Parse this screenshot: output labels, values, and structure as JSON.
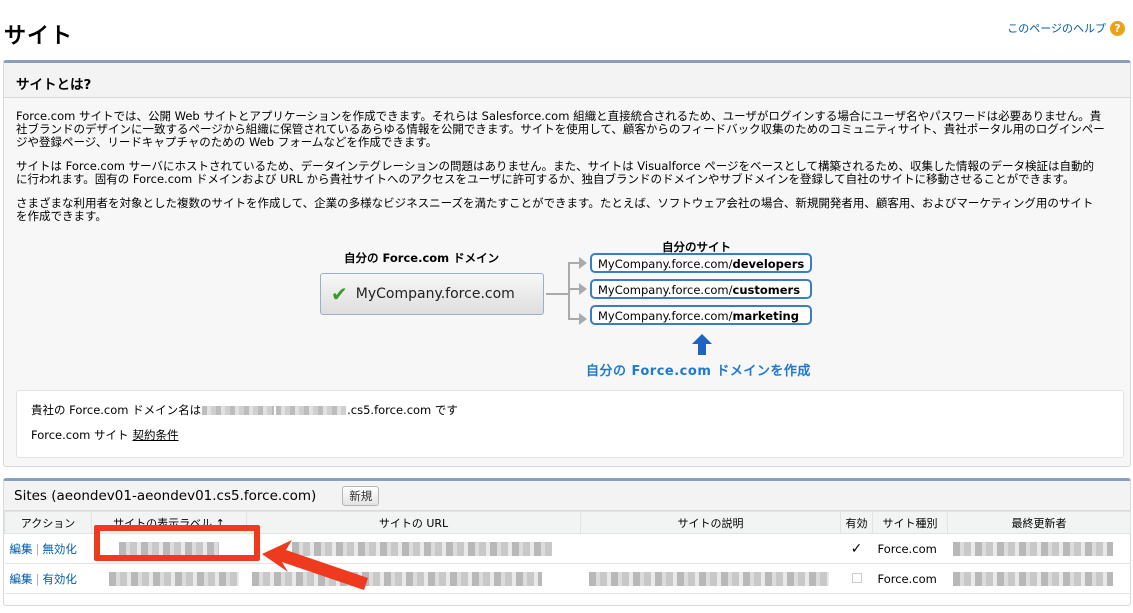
{
  "page": {
    "title": "サイト",
    "help_link": "このページのヘルプ",
    "help_icon": "?"
  },
  "about": {
    "header": "サイトとは?",
    "paragraphs": [
      "Force.com サイトでは、公開 Web サイトとアプリケーションを作成できます。それらは Salesforce.com 組織と直接統合されるため、ユーザがログインする場合にユーザ名やパスワードは必要ありません。貴\n社ブランドのデザインに一致するページから組織に保管されているあらゆる情報を公開できます。サイトを使用して、顧客からのフィードバック収集のためのコミュニティサイト、貴社ポータル用のログインペー\nジや登録ページ、リードキャプチャのための Web フォームなどを作成できます。",
      "サイトは Force.com サーバにホストされているため、データインテグレーションの問題はありません。また、サイトは Visualforce ページをベースとして構築されるため、収集した情報のデータ検証は自動的\nに行われます。固有の Force.com ドメインおよび URL から貴社サイトへのアクセスをユーザに許可するか、独自ブランドのドメインやサブドメインを登録して自社のサイトに移動させることができます。",
      "さまざまな利用者を対象とした複数のサイトを作成して、企業の多様なビジネスニーズを満たすことができます。たとえば、ソフトウェア会社の場合、新規開発者用、顧客用、およびマーケティング用のサイト\nを作成できます。"
    ],
    "diagram": {
      "domain_label": "自分の Force.com ドメイン",
      "sites_label": "自分のサイト",
      "domain": "MyCompany.force.com",
      "sites": [
        {
          "prefix": "MyCompany.force.com/",
          "path": "developers"
        },
        {
          "prefix": "MyCompany.force.com/",
          "path": "customers"
        },
        {
          "prefix": "MyCompany.force.com/",
          "path": "marketing"
        }
      ],
      "create_link": "自分の Force.com ドメインを作成"
    },
    "info": {
      "domain_prefix": "貴社の Force.com ドメイン名は",
      "domain_suffix": ".cs5.force.com です",
      "terms_prefix": "Force.com サイト",
      "terms_link": "契約条件"
    }
  },
  "sites": {
    "title": "Sites (aeondev01-aeondev01.cs5.force.com)",
    "new_button": "新規",
    "columns": [
      "アクション",
      "サイトの表示ラベル ↑",
      "サイトの URL",
      "サイトの説明",
      "有効",
      "サイト種別",
      "最終更新者"
    ],
    "rows": [
      {
        "edit": "編集",
        "toggle": "無効化",
        "active": "✓",
        "type": "Force.com"
      },
      {
        "edit": "編集",
        "toggle": "有効化",
        "active": "",
        "type": "Force.com"
      }
    ]
  },
  "colors": {
    "accent_blue": "#015ba7",
    "highlight_red": "#ee3a1e",
    "panel_border": "#8a9ebe"
  }
}
